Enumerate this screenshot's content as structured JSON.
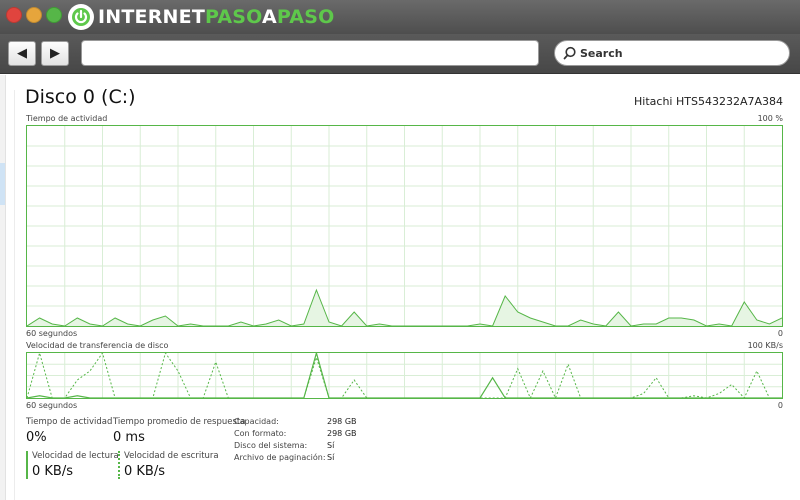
{
  "browser": {
    "logo": {
      "part1": "INTERNET",
      "part2": "PASO",
      "part3": "A",
      "part4": "PASO"
    },
    "nav": {
      "back_icon": "◀",
      "forward_icon": "▶"
    },
    "url": "",
    "search_label": "Search",
    "colors": {
      "brand_green": "#5ec84b",
      "chrome_dark": "#4e4e4e"
    }
  },
  "disk": {
    "title": "Disco 0 (C:)",
    "model": "Hitachi HTS543232A7A384"
  },
  "activity_graph": {
    "label": "Tiempo de actividad",
    "max_label": "100 %",
    "time_label": "60 segundos",
    "min_label": "0"
  },
  "transfer_graph": {
    "label": "Velocidad de transferencia de disco",
    "max_label": "100 KB/s",
    "time_label": "60 segundos",
    "min_label": "0"
  },
  "stats": {
    "activity_label": "Tiempo de actividad",
    "activity_value": "0%",
    "response_label": "Tiempo promedio de respuesta",
    "response_value": "0 ms",
    "read_label": "Velocidad de lectura",
    "read_value": "0 KB/s",
    "write_label": "Velocidad de escritura",
    "write_value": "0 KB/s"
  },
  "properties": {
    "capacity_label": "Capacidad:",
    "capacity_value": "298 GB",
    "formatted_label": "Con formato:",
    "formatted_value": "298 GB",
    "system_disk_label": "Disco del sistema:",
    "system_disk_value": "Sí",
    "pagefile_label": "Archivo de paginación:",
    "pagefile_value": "Sí"
  },
  "chart_data": [
    {
      "type": "area",
      "title": "Tiempo de actividad",
      "xlabel": "60 segundos",
      "ylabel": "",
      "ylim": [
        0,
        100
      ],
      "x": [
        0,
        1,
        2,
        3,
        4,
        5,
        6,
        7,
        8,
        9,
        10,
        11,
        12,
        13,
        14,
        15,
        16,
        17,
        18,
        19,
        20,
        21,
        22,
        23,
        24,
        25,
        26,
        27,
        28,
        29,
        30,
        31,
        32,
        33,
        34,
        35,
        36,
        37,
        38,
        39,
        40,
        41,
        42,
        43,
        44,
        45,
        46,
        47,
        48,
        49,
        50,
        51,
        52,
        53,
        54,
        55,
        56,
        57,
        58,
        59,
        60
      ],
      "series": [
        {
          "values": [
            0,
            4,
            1,
            0,
            4,
            1,
            0,
            4,
            1,
            0,
            3,
            5,
            0,
            1,
            0,
            0,
            0,
            2,
            0,
            1,
            3,
            0,
            1,
            18,
            2,
            0,
            7,
            0,
            1,
            0,
            0,
            0,
            0,
            0,
            0,
            0,
            1,
            0,
            15,
            7,
            4,
            2,
            0,
            0,
            3,
            1,
            0,
            7,
            0,
            1,
            1,
            4,
            4,
            3,
            0,
            1,
            0,
            12,
            3,
            1,
            4
          ]
        }
      ],
      "grid": true,
      "color": "#56b648"
    },
    {
      "type": "line",
      "title": "Velocidad de transferencia de disco",
      "xlabel": "60 segundos",
      "ylabel": "",
      "ylim": [
        0,
        100
      ],
      "x": [
        0,
        1,
        2,
        3,
        4,
        5,
        6,
        7,
        8,
        9,
        10,
        11,
        12,
        13,
        14,
        15,
        16,
        17,
        18,
        19,
        20,
        21,
        22,
        23,
        24,
        25,
        26,
        27,
        28,
        29,
        30,
        31,
        32,
        33,
        34,
        35,
        36,
        37,
        38,
        39,
        40,
        41,
        42,
        43,
        44,
        45,
        46,
        47,
        48,
        49,
        50,
        51,
        52,
        53,
        54,
        55,
        56,
        57,
        58,
        59,
        60
      ],
      "series": [
        {
          "name": "Velocidad de lectura",
          "values": [
            0,
            5,
            0,
            0,
            5,
            0,
            0,
            0,
            0,
            0,
            0,
            0,
            0,
            0,
            0,
            0,
            0,
            0,
            0,
            0,
            0,
            0,
            0,
            100,
            0,
            0,
            0,
            0,
            0,
            0,
            0,
            0,
            0,
            0,
            0,
            0,
            0,
            45,
            0,
            0,
            0,
            0,
            0,
            0,
            0,
            0,
            0,
            0,
            0,
            0,
            0,
            0,
            0,
            0,
            0,
            0,
            0,
            0,
            0,
            0,
            0
          ]
        },
        {
          "name": "Velocidad de escritura",
          "values": [
            0,
            100,
            0,
            0,
            40,
            60,
            100,
            0,
            0,
            0,
            0,
            100,
            60,
            0,
            0,
            80,
            0,
            0,
            0,
            0,
            0,
            0,
            0,
            90,
            0,
            0,
            40,
            0,
            0,
            0,
            0,
            0,
            0,
            0,
            0,
            0,
            0,
            0,
            0,
            65,
            0,
            60,
            0,
            75,
            0,
            0,
            0,
            0,
            0,
            10,
            45,
            0,
            0,
            5,
            0,
            10,
            30,
            0,
            60,
            0,
            0
          ]
        }
      ],
      "grid": true,
      "color": "#56b648"
    }
  ]
}
